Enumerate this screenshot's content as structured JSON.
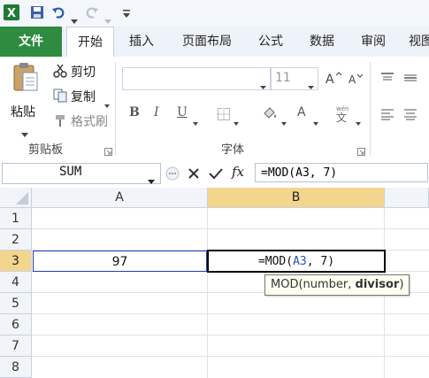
{
  "tabs": [
    "文件",
    "开始",
    "插入",
    "页面布局",
    "公式",
    "数据",
    "审阅",
    "视图"
  ],
  "ribbon": {
    "clipboard": {
      "paste": "粘贴",
      "cut": "剪切",
      "copy": "复制",
      "format_painter": "格式刷",
      "group_label": "剪贴板"
    },
    "font": {
      "font_size": "11",
      "group_label": "字体",
      "bold": "B",
      "italic": "I",
      "underline": "U"
    }
  },
  "formula_bar": {
    "name_box": "SUM",
    "fx": "fx",
    "formula": "=MOD(A3, 7)"
  },
  "grid": {
    "columns": [
      "A",
      "B"
    ],
    "rows": [
      "1",
      "2",
      "3",
      "4",
      "5",
      "6",
      "7",
      "8"
    ],
    "cells": {
      "A3": "97",
      "B3_prefix": "=MOD(",
      "B3_ref": "A3",
      "B3_suffix": ", 7)"
    }
  },
  "tooltip": {
    "func": "MOD(number, ",
    "bold_arg": "divisor",
    "close": ")"
  },
  "colors": {
    "file_tab": "#2e8b3f",
    "active_header": "#f4d58d",
    "cell_ref": "#2a4ec4",
    "active_cell_border": "#000000",
    "ref_cell_border": "#1f3fae"
  }
}
